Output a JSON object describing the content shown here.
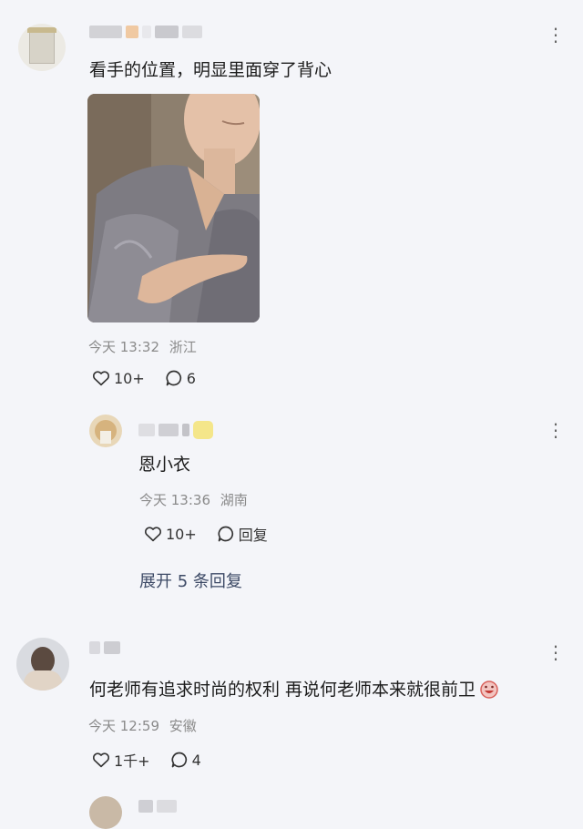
{
  "comments": [
    {
      "text": "看手的位置，明显里面穿了背心",
      "time": "今天 13:32",
      "location": "浙江",
      "likes": "10+",
      "replies_count": "6"
    },
    {
      "text": "何老师有追求时尚的权利 再说何老师本来就很前卫",
      "time": "今天 12:59",
      "location": "安徽",
      "likes": "1千+",
      "replies_count": "4"
    }
  ],
  "reply": {
    "text": "恩小衣",
    "time": "今天 13:36",
    "location": "湖南",
    "likes": "10+",
    "reply_label": "回复"
  },
  "expand_label": "展开 5 条回复",
  "icons": {
    "like": "heart-icon",
    "comment": "speech-bubble-icon",
    "more": "more-dots-icon"
  }
}
